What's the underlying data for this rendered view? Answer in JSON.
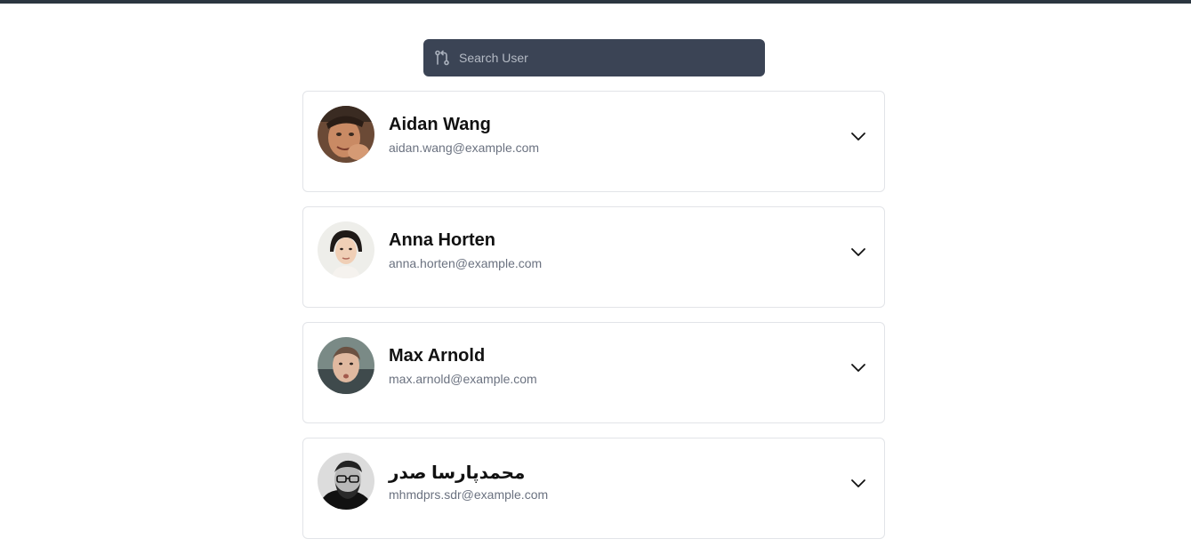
{
  "search": {
    "placeholder": "Search User"
  },
  "users": [
    {
      "name": "Aidan Wang",
      "email": "aidan.wang@example.com"
    },
    {
      "name": "Anna Horten",
      "email": "anna.horten@example.com"
    },
    {
      "name": "Max Arnold",
      "email": "max.arnold@example.com"
    },
    {
      "name": "محمدپارسا صدر",
      "email": "mhmdprs.sdr@example.com"
    }
  ],
  "colors": {
    "topbar": "#2b3640",
    "search_background": "#3b4455",
    "card_border": "#e2e4e8",
    "email_text": "#6b7280"
  },
  "icons": {
    "search": "git-pull-request-icon",
    "expand": "chevron-down-icon"
  }
}
